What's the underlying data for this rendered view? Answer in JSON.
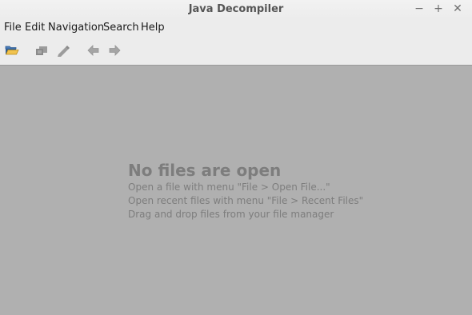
{
  "window": {
    "title": "Java Decompiler",
    "minimize_glyph": "−",
    "maximize_glyph": "+",
    "close_glyph": "✕"
  },
  "menu": {
    "items": [
      {
        "label": "File"
      },
      {
        "label": "Edit"
      },
      {
        "label": "Navigation"
      },
      {
        "label": "Search"
      },
      {
        "label": "Help"
      }
    ]
  },
  "toolbar": {
    "buttons": [
      {
        "icon": "open-folder-icon",
        "enabled": true
      },
      {
        "icon": "save-icon",
        "enabled": false
      },
      {
        "icon": "edit-icon",
        "enabled": false
      },
      {
        "icon": "back-arrow-icon",
        "enabled": false
      },
      {
        "icon": "forward-arrow-icon",
        "enabled": false
      }
    ]
  },
  "empty_state": {
    "title": "No files are open",
    "lines": [
      "Open a file with menu \"File > Open File...\"",
      "Open recent files with menu \"File > Recent Files\"",
      "Drag and drop files from your file manager"
    ]
  },
  "colors": {
    "content_background": "#b0b0b0",
    "chrome_background": "#ececec",
    "hint_text": "#7d7d7d"
  }
}
